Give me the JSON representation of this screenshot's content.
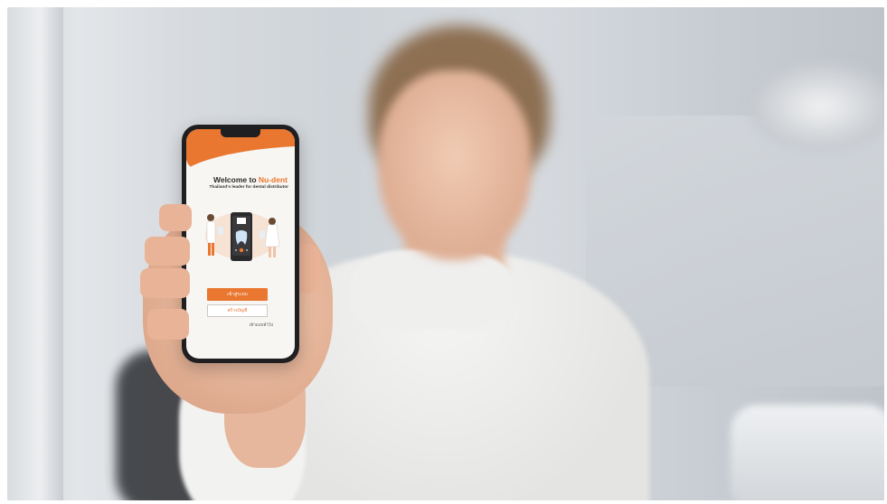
{
  "app": {
    "welcome_prefix": "Welcome to",
    "brand_name": "Nu-dent",
    "tagline": "Thailand's leader for dental distributor",
    "login_button": "เข้าสู่ระบบ",
    "register_button": "สร้างบัญชี",
    "guest_link": "เข้าแบบทั่วไป"
  },
  "colors": {
    "accent": "#e9772f",
    "screen_bg": "#f8f6f3",
    "phone_frame": "#1f1f21"
  },
  "icons": {
    "illustration": "dentist-app-illustration-icon",
    "tooth": "tooth-icon",
    "app_logo": "nu-dent-logo-icon"
  }
}
